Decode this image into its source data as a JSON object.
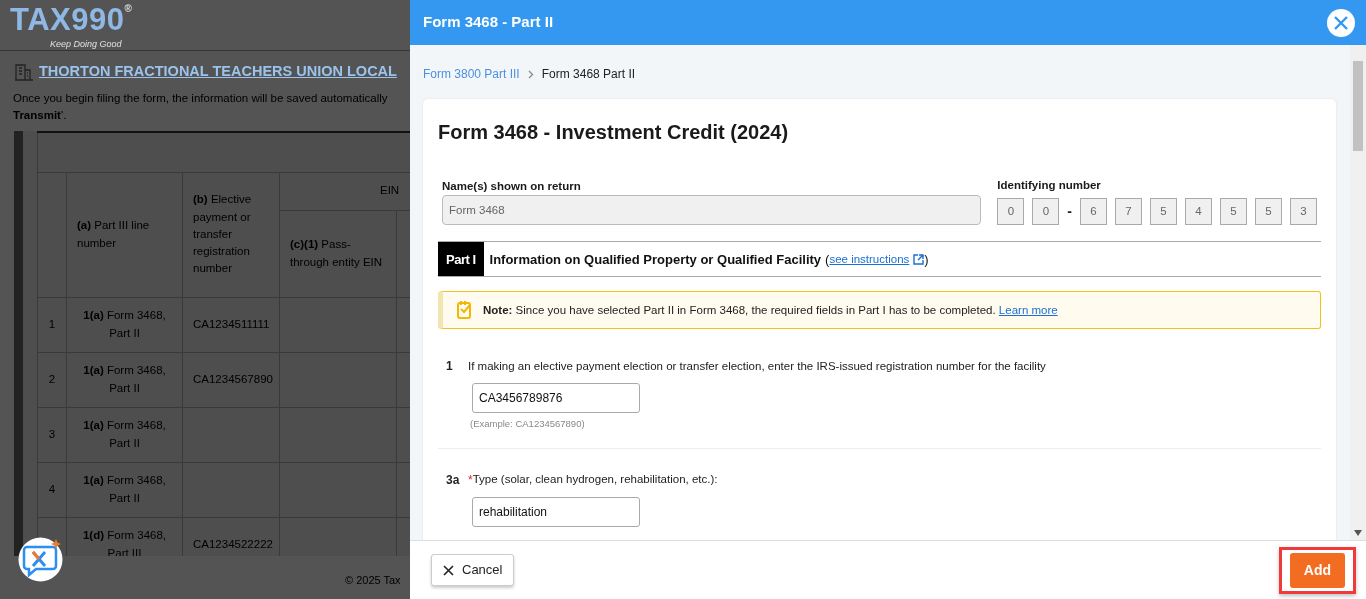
{
  "background_page": {
    "logo": {
      "name": "TAX990",
      "registered": "®",
      "tagline": "Keep Doing Good"
    },
    "organization_title": "THORTON FRACTIONAL TEACHERS UNION LOCAL",
    "instructions": [
      "Once you begin filing the form, the information will be saved automatically",
      "**Transmit**'."
    ],
    "table": {
      "header_group": "EIN",
      "columns": [
        "**(a)** Part III line number",
        "**(b)** Elective payment or transfer registration number",
        "**(c)(1)** Pass-through entity EIN"
      ],
      "rows": [
        {
          "number": "1",
          "line": "**1(a)** Form 3468, Part II",
          "registration": "CA1234511111"
        },
        {
          "number": "2",
          "line": "**1(a)** Form 3468, Part II",
          "registration": "CA1234567890"
        },
        {
          "number": "3",
          "line": "**1(a)** Form 3468, Part II"
        },
        {
          "number": "4",
          "line": "**1(a)** Form 3468, Part II"
        },
        {
          "line": "**1(d)** Form 3468, Part III",
          "registration": "CA1234522222"
        }
      ]
    },
    "footer": "© 2025 Tax"
  },
  "dialog": {
    "title": "Form 3468 - Part II",
    "breadcrumb": [
      {
        "kind": "link",
        "label": "Form 3800 Part III"
      },
      {
        "kind": "current",
        "label": "Form 3468 Part II"
      }
    ],
    "form": {
      "title": "Form 3468 - Investment Credit (2024)",
      "name_label": "Name(s) shown on return",
      "name_value": "Form 3468",
      "id_label": "Identifying number",
      "id_parts": [
        {
          "kind": "digit",
          "text": "0"
        },
        {
          "kind": "digit",
          "text": "0"
        },
        {
          "kind": "separator",
          "text": "-"
        },
        {
          "kind": "digit",
          "text": "6"
        },
        {
          "kind": "digit",
          "text": "7"
        },
        {
          "kind": "digit",
          "text": "5"
        },
        {
          "kind": "digit",
          "text": "4"
        },
        {
          "kind": "digit",
          "text": "5"
        },
        {
          "kind": "digit",
          "text": "5"
        },
        {
          "kind": "digit",
          "text": "3"
        }
      ],
      "part": {
        "badge": "Part I",
        "title": "Information on Qualified Property or Qualified Facility",
        "link_open": "(",
        "link": "see instructions",
        "link_close": ")"
      },
      "note": {
        "text": "**Note:** Since you have selected Part II in Form 3468, the required fields in Part I has to be completed.",
        "link": "Learn more"
      },
      "lines": [
        {
          "number": "1",
          "label": "If making an elective payment election or transfer election, enter the IRS-issued registration number for the facility",
          "value": "CA3456789876",
          "hint": "(Example: CA1234567890)"
        },
        {
          "number": "3a",
          "marker": "*",
          "label": "Type (solar, clean hydrogen, rehabilitation, etc.):",
          "value": "rehabilitation"
        }
      ]
    },
    "cancel_button": "Cancel",
    "add_button": "Add"
  }
}
